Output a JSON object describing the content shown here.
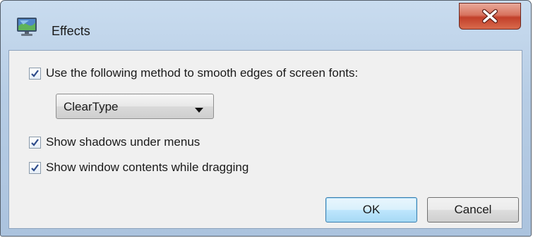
{
  "window": {
    "title": "Effects",
    "app_icon": "monitor-display-icon",
    "close_icon": "close-icon"
  },
  "options": {
    "smooth_edges": {
      "label": "Use the following method to smooth edges of screen fonts:",
      "checked": true
    },
    "smoothing_method": {
      "selected": "ClearType",
      "icon": "chevron-down-icon"
    },
    "shadows": {
      "label": "Show shadows under menus",
      "checked": true
    },
    "drag_contents": {
      "label": "Show window contents while dragging",
      "checked": true
    }
  },
  "buttons": {
    "ok": "OK",
    "cancel": "Cancel"
  },
  "colors": {
    "titlebar": "#b7cde5",
    "close_button": "#c2402a",
    "dialog_body": "#f0f0f0",
    "default_button": "#bee6fd",
    "checkmark": "#2c4a8a"
  }
}
